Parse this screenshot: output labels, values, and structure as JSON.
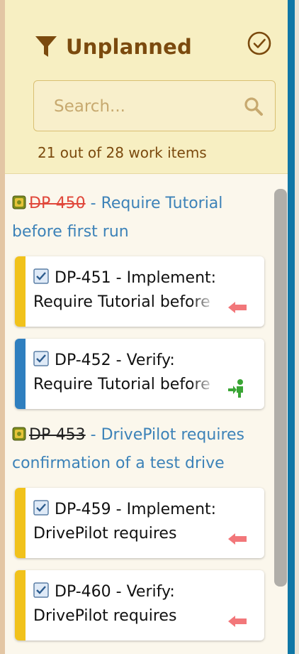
{
  "header": {
    "title": "Unplanned",
    "search": {
      "placeholder": "Search..."
    },
    "count_text": "21 out of 28 work items"
  },
  "colors": {
    "title": "#7b4a0e",
    "link": "#3c82b8",
    "strike_red": "#e0473a",
    "bar_yellow": "#f1c21b",
    "bar_blue": "#2f7fbf",
    "arrow_red": "#f2777a",
    "person_green": "#3aa535"
  },
  "groups": [
    {
      "id": "DP-450",
      "title": " - Require Tutorial before first run",
      "items": [
        {
          "id": "DP-451",
          "line1": "DP-451 - Implement:",
          "line2": "Require Tutorial before",
          "status_icon": "left-arrow-icon",
          "bar": "yellow"
        },
        {
          "id": "DP-452",
          "line1": "DP-452 - Verify:",
          "line2": "Require Tutorial before",
          "status_icon": "person-enter-icon",
          "bar": "blue"
        }
      ]
    },
    {
      "id": "DP-453",
      "title": " - DrivePilot requires confirmation of a test drive",
      "items": [
        {
          "id": "DP-459",
          "line1": "DP-459 - Implement:",
          "line2": "DrivePilot requires",
          "status_icon": "left-arrow-icon",
          "bar": "yellow"
        },
        {
          "id": "DP-460",
          "line1": "DP-460 - Verify:",
          "line2": "DrivePilot requires",
          "status_icon": "left-arrow-icon",
          "bar": "yellow"
        }
      ]
    }
  ]
}
